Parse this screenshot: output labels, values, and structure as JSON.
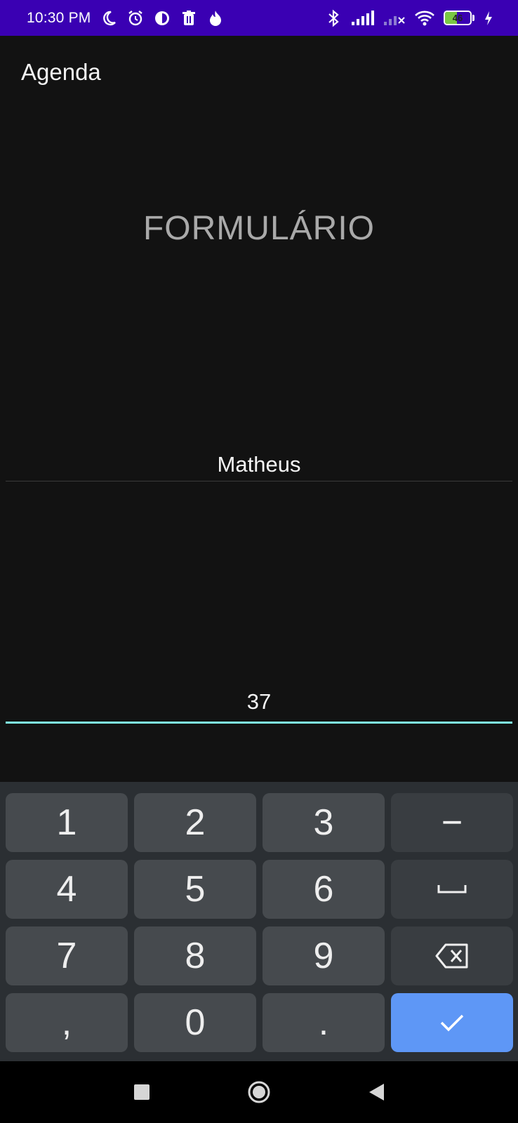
{
  "status_bar": {
    "time": "10:30 PM",
    "icons_left": [
      "moon-icon",
      "alarm-icon",
      "app-icon",
      "trash-icon",
      "flame-icon"
    ],
    "icons_right": [
      "bluetooth-icon",
      "signal-icon",
      "signal-off-icon",
      "wifi-icon",
      "battery-icon",
      "charging-icon"
    ],
    "battery_level": "46",
    "battery_fraction": 0.46,
    "bar_color": "#3a00b3"
  },
  "app_bar": {
    "title": "Agenda"
  },
  "form": {
    "heading": "FORMULÁRIO",
    "name_value": "Matheus",
    "age_value": "37",
    "focus_color": "#7ff3e6"
  },
  "keyboard": {
    "keys": [
      {
        "label": "1",
        "name": "key-1"
      },
      {
        "label": "2",
        "name": "key-2"
      },
      {
        "label": "3",
        "name": "key-3"
      },
      {
        "label": "−",
        "name": "key-minus"
      },
      {
        "label": "4",
        "name": "key-4"
      },
      {
        "label": "5",
        "name": "key-5"
      },
      {
        "label": "6",
        "name": "key-6"
      },
      {
        "label": "",
        "name": "key-space",
        "icon": "space-icon"
      },
      {
        "label": "7",
        "name": "key-7"
      },
      {
        "label": "8",
        "name": "key-8"
      },
      {
        "label": "9",
        "name": "key-9"
      },
      {
        "label": "",
        "name": "key-backspace",
        "icon": "backspace-icon"
      },
      {
        "label": ",",
        "name": "key-comma"
      },
      {
        "label": "0",
        "name": "key-0"
      },
      {
        "label": ".",
        "name": "key-period"
      },
      {
        "label": "",
        "name": "key-done",
        "icon": "check-icon"
      }
    ],
    "enter_color": "#5e97f6"
  },
  "nav_bar": {
    "buttons": [
      "recents-icon",
      "home-icon",
      "back-icon"
    ]
  }
}
